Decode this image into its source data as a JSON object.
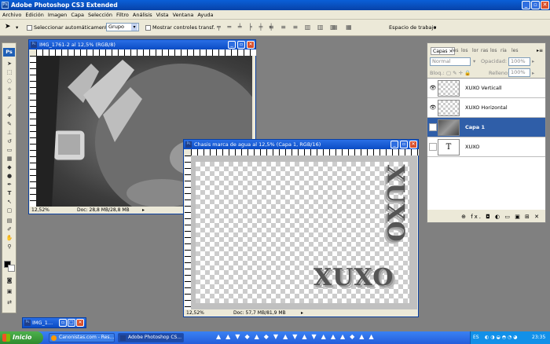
{
  "app": {
    "title": "Adobe Photoshop CS3 Extended"
  },
  "menu": [
    "Archivo",
    "Edición",
    "Imagen",
    "Capa",
    "Selección",
    "Filtro",
    "Análisis",
    "Vista",
    "Ventana",
    "Ayuda"
  ],
  "options": {
    "autoselect_label": "Seleccionar automáticamente:",
    "group_value": "Grupo",
    "transform_label": "Mostrar controles transf.",
    "workspace_label": "Espacio de trabajo"
  },
  "toolbox": {
    "logo": "Ps"
  },
  "doc1": {
    "title": "IMG_1761-2 al 12,5% (RGB/8)",
    "zoom": "12,52%",
    "info": "Doc: 28,8 MB/28,8 MB"
  },
  "doc2": {
    "title": "Chasis marca de agua al 12,5% (Capa 1, RGB/16)",
    "zoom": "12,52%",
    "info": "Doc: 57,7 MB/81,9 MB",
    "watermark": "XUXO"
  },
  "layers": {
    "tabs": [
      "Capas ×",
      "les",
      "los",
      "lor",
      "ras",
      "los",
      "ria",
      "les"
    ],
    "blend": "Normal",
    "opacity_label": "Opacidad:",
    "opacity": "100%",
    "lock_label": "Bloq.:",
    "fill_label": "Relleno:",
    "fill": "100%",
    "rows": [
      {
        "name": "XUXO Verticall"
      },
      {
        "name": "XUXO Horizontal"
      },
      {
        "name": "Capa 1"
      },
      {
        "name": "XUXO",
        "thumb": "T"
      }
    ],
    "footer_icons": "⊕ fx. ◘ ◐ ▭ ▣ ⊞ ✕"
  },
  "minimized": {
    "title": "IMG_1..."
  },
  "taskbar": {
    "start": "Inicio",
    "items": [
      "Canonistas.com - Res...",
      "Adobe Photoshop CS..."
    ],
    "lang": "ES",
    "time": "23:35"
  },
  "colors": {
    "accent": "#2f5ea8",
    "titlebar": "#0a4bc4",
    "taskbar": "#245edb"
  }
}
